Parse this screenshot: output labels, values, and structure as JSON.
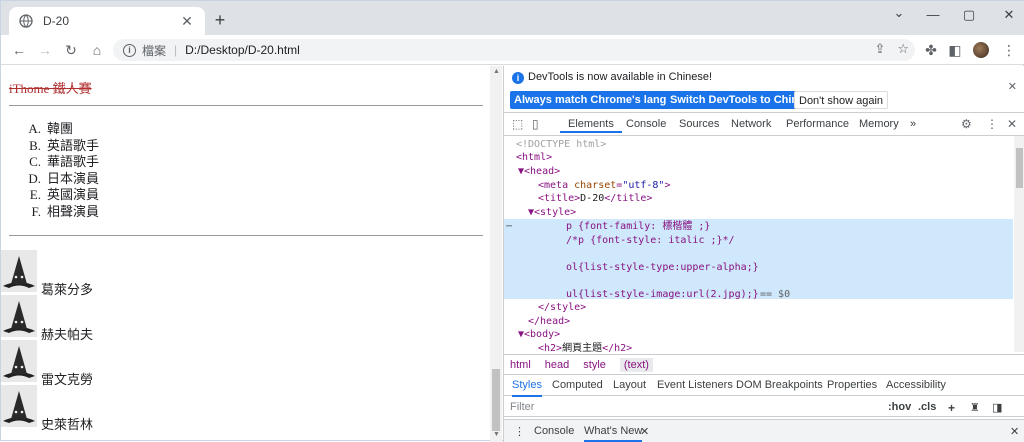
{
  "browser": {
    "tab_title": "D-20",
    "omnibox_label": "檔案",
    "url": "D:/Desktop/D-20.html"
  },
  "page": {
    "heading": "iThome 鐵人賽",
    "ordered_list": [
      {
        "marker": "A.",
        "text": "韓團"
      },
      {
        "marker": "B.",
        "text": "英語歌手"
      },
      {
        "marker": "C.",
        "text": "華語歌手"
      },
      {
        "marker": "D.",
        "text": "日本演員"
      },
      {
        "marker": "E.",
        "text": "英國演員"
      },
      {
        "marker": "F.",
        "text": "相聲演員"
      }
    ],
    "image_list": [
      "葛萊分多",
      "赫夫帕夫",
      "雷文克勞",
      "史萊哲林"
    ]
  },
  "devtools": {
    "banner_message": "DevTools is now available in Chinese!",
    "btn_match": "Always match Chrome's language",
    "btn_switch": "Switch DevTools to Chinese",
    "btn_dont_show": "Don't show again",
    "tabs": [
      "Elements",
      "Console",
      "Sources",
      "Network",
      "Performance",
      "Memory"
    ],
    "more_tabs": "»",
    "code_lines": [
      {
        "html": "<span class='cm'>&lt;!DOCTYPE html&gt;</span>"
      },
      {
        "html": "<span class='tag'>&lt;html&gt;</span>"
      },
      {
        "html": "<span class='tag'>▼&lt;head&gt;</span>"
      },
      {
        "html": "<span class='tag'>&lt;meta </span><span class='attr'>charset</span><span class='tag'>=</span><span class='val'>\"utf-8\"</span><span class='tag'>&gt;</span>"
      },
      {
        "html": "<span class='tag'>&lt;title&gt;</span>D-20<span class='tag'>&lt;/title&gt;</span>"
      },
      {
        "html": "<span class='tag'>▼&lt;style&gt;</span>"
      }
    ],
    "style_lines": [
      "p {font-family: 標楷體 ;}",
      "/*p {font-style: italic ;}*/",
      "",
      "ol{list-style-type:upper-alpha;}",
      "",
      "ul{list-style-image:url(2.jpg);}"
    ],
    "dollar0": "== $0",
    "crumbs": [
      "html",
      "head",
      "style",
      "(text)"
    ],
    "style_tabs": [
      "Styles",
      "Computed",
      "Layout",
      "Event Listeners",
      "DOM Breakpoints",
      "Properties",
      "Accessibility"
    ],
    "filter_placeholder": "Filter",
    "hov": ":hov",
    "cls": ".cls",
    "drawer_tabs": [
      "Console",
      "What's New"
    ]
  }
}
